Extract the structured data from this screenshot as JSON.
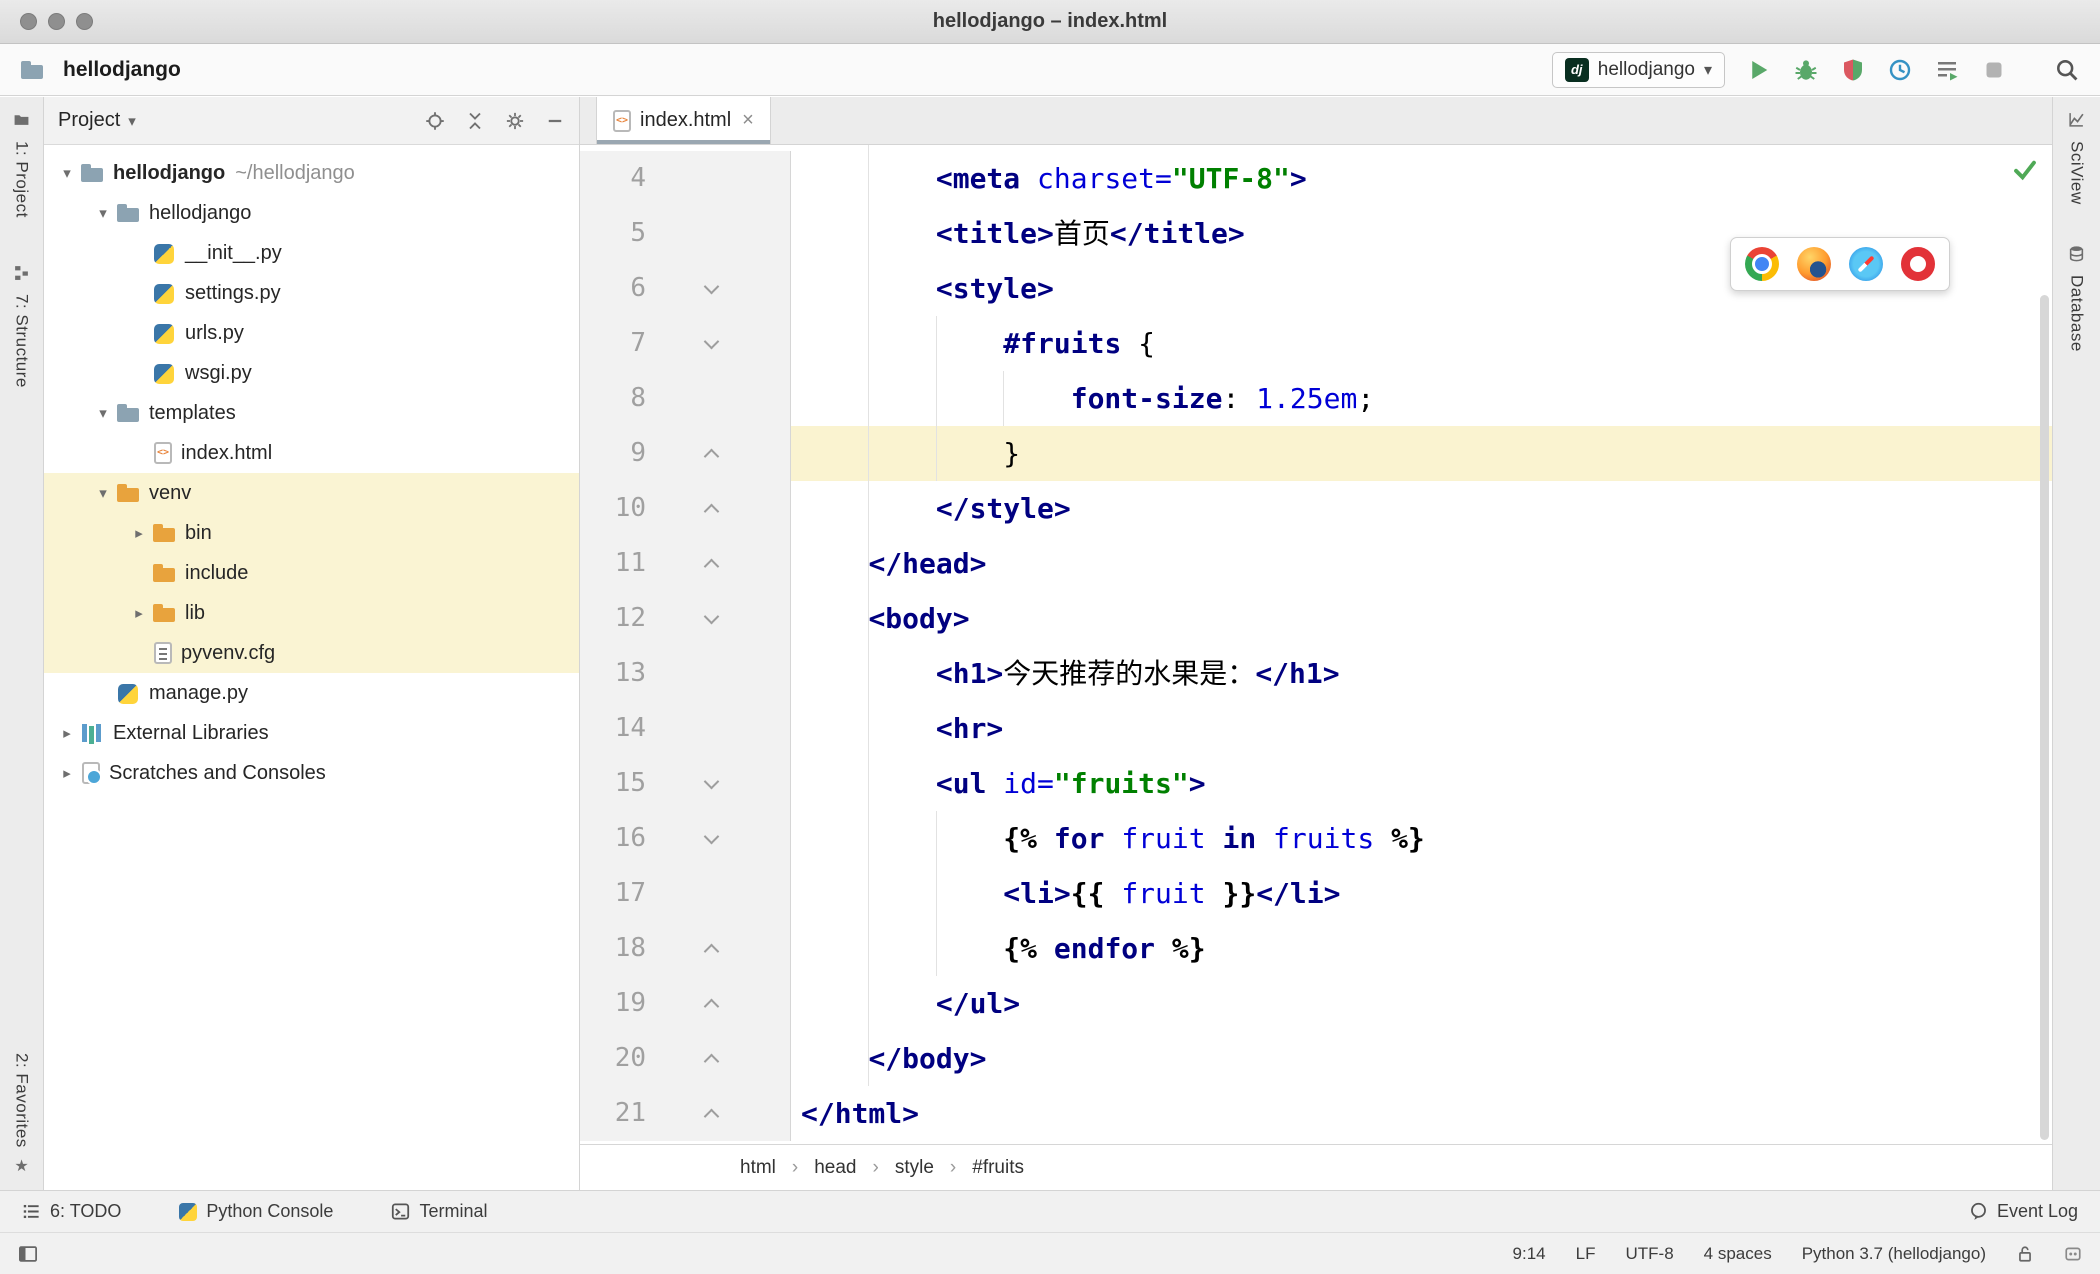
{
  "window": {
    "title": "hellodjango – index.html"
  },
  "toolbar": {
    "project_name": "hellodjango",
    "run_config": {
      "badge": "dj",
      "name": "hellodjango"
    }
  },
  "left_stripe": {
    "project": "1: Project",
    "structure": "7: Structure",
    "favorites": "2: Favorites"
  },
  "right_stripe": {
    "sciview": "SciView",
    "database": "Database"
  },
  "project_panel": {
    "title": "Project",
    "tree": [
      {
        "indent": 0,
        "chevron": "down",
        "icon": "folder-blue",
        "label": "hellodjango",
        "suffix": "~/hellodjango",
        "bold": true
      },
      {
        "indent": 1,
        "chevron": "down",
        "icon": "folder-blue",
        "label": "hellodjango"
      },
      {
        "indent": 2,
        "chevron": null,
        "icon": "python",
        "label": "__init__.py"
      },
      {
        "indent": 2,
        "chevron": null,
        "icon": "python",
        "label": "settings.py"
      },
      {
        "indent": 2,
        "chevron": null,
        "icon": "python",
        "label": "urls.py"
      },
      {
        "indent": 2,
        "chevron": null,
        "icon": "python",
        "label": "wsgi.py"
      },
      {
        "indent": 1,
        "chevron": "down",
        "icon": "folder-blue",
        "label": "templates"
      },
      {
        "indent": 2,
        "chevron": null,
        "icon": "html-file",
        "label": "index.html"
      },
      {
        "indent": 1,
        "chevron": "down",
        "icon": "folder-orange",
        "label": "venv",
        "hl": true
      },
      {
        "indent": 2,
        "chevron": "right",
        "icon": "folder-orange",
        "label": "bin",
        "hl": true
      },
      {
        "indent": 2,
        "chevron": null,
        "icon": "folder-orange",
        "label": "include",
        "hl": true
      },
      {
        "indent": 2,
        "chevron": "right",
        "icon": "folder-orange",
        "label": "lib",
        "hl": true
      },
      {
        "indent": 2,
        "chevron": null,
        "icon": "cfg-file",
        "label": "pyvenv.cfg",
        "hl": true
      },
      {
        "indent": 1,
        "chevron": null,
        "icon": "python",
        "label": "manage.py"
      },
      {
        "indent": 0,
        "chevron": "right",
        "icon": "libs",
        "label": "External Libraries"
      },
      {
        "indent": 0,
        "chevron": "right",
        "icon": "scratches",
        "label": "Scratches and Consoles"
      }
    ]
  },
  "editor": {
    "tab": {
      "name": "index.html"
    },
    "breadcrumbs": [
      "html",
      "head",
      "style",
      "#fruits"
    ],
    "lines": [
      {
        "n": 4,
        "ind": 8,
        "fold": null,
        "t": [
          {
            "c": "tag",
            "s": "<meta "
          },
          {
            "c": "attr",
            "s": "charset="
          },
          {
            "c": "str",
            "s": "\"UTF-8\""
          },
          {
            "c": "tag",
            "s": ">"
          }
        ]
      },
      {
        "n": 5,
        "ind": 8,
        "fold": null,
        "t": [
          {
            "c": "tag",
            "s": "<title>"
          },
          {
            "c": "txt",
            "s": "首页"
          },
          {
            "c": "tag",
            "s": "</title>"
          }
        ]
      },
      {
        "n": 6,
        "ind": 8,
        "fold": "down",
        "t": [
          {
            "c": "tag",
            "s": "<style>"
          }
        ]
      },
      {
        "n": 7,
        "ind": 12,
        "fold": "down",
        "t": [
          {
            "c": "kw",
            "s": "#fruits"
          },
          {
            "c": "pun",
            "s": " {"
          }
        ]
      },
      {
        "n": 8,
        "ind": 16,
        "fold": null,
        "t": [
          {
            "c": "prop",
            "s": "font-size"
          },
          {
            "c": "pun",
            "s": ": "
          },
          {
            "c": "num",
            "s": "1.25em"
          },
          {
            "c": "pun",
            "s": ";"
          }
        ]
      },
      {
        "n": 9,
        "ind": 12,
        "fold": "up",
        "active": true,
        "t": [
          {
            "c": "pun",
            "s": "}"
          }
        ]
      },
      {
        "n": 10,
        "ind": 8,
        "fold": "up",
        "t": [
          {
            "c": "tag",
            "s": "</style>"
          }
        ]
      },
      {
        "n": 11,
        "ind": 4,
        "fold": "up",
        "t": [
          {
            "c": "tag",
            "s": "</head>"
          }
        ]
      },
      {
        "n": 12,
        "ind": 4,
        "fold": "down",
        "t": [
          {
            "c": "tag",
            "s": "<body>"
          }
        ]
      },
      {
        "n": 13,
        "ind": 8,
        "fold": null,
        "t": [
          {
            "c": "tag",
            "s": "<h1>"
          },
          {
            "c": "txt",
            "s": "今天推荐的水果是："
          },
          {
            "c": "tag",
            "s": "</h1>"
          }
        ]
      },
      {
        "n": 14,
        "ind": 8,
        "fold": null,
        "t": [
          {
            "c": "tag",
            "s": "<hr>"
          }
        ]
      },
      {
        "n": 15,
        "ind": 8,
        "fold": "down",
        "t": [
          {
            "c": "tag",
            "s": "<ul "
          },
          {
            "c": "attr",
            "s": "id="
          },
          {
            "c": "str",
            "s": "\"fruits\""
          },
          {
            "c": "tag",
            "s": ">"
          }
        ]
      },
      {
        "n": 16,
        "ind": 12,
        "fold": "down",
        "t": [
          {
            "c": "brc",
            "s": "{% "
          },
          {
            "c": "kw",
            "s": "for"
          },
          {
            "c": "pun",
            "s": " "
          },
          {
            "c": "var",
            "s": "fruit"
          },
          {
            "c": "pun",
            "s": " "
          },
          {
            "c": "kw",
            "s": "in"
          },
          {
            "c": "pun",
            "s": " "
          },
          {
            "c": "var",
            "s": "fruits"
          },
          {
            "c": "pun",
            "s": " "
          },
          {
            "c": "brc",
            "s": "%}"
          }
        ]
      },
      {
        "n": 17,
        "ind": 12,
        "fold": null,
        "t": [
          {
            "c": "tag",
            "s": "<li>"
          },
          {
            "c": "brc",
            "s": "{{ "
          },
          {
            "c": "var",
            "s": "fruit"
          },
          {
            "c": "brc",
            "s": " }}"
          },
          {
            "c": "tag",
            "s": "</li>"
          }
        ]
      },
      {
        "n": 18,
        "ind": 12,
        "fold": "up",
        "t": [
          {
            "c": "brc",
            "s": "{% "
          },
          {
            "c": "kw",
            "s": "endfor"
          },
          {
            "c": "pun",
            "s": " "
          },
          {
            "c": "brc",
            "s": "%}"
          }
        ]
      },
      {
        "n": 19,
        "ind": 8,
        "fold": "up",
        "t": [
          {
            "c": "tag",
            "s": "</ul>"
          }
        ]
      },
      {
        "n": 20,
        "ind": 4,
        "fold": "up",
        "t": [
          {
            "c": "tag",
            "s": "</body>"
          }
        ]
      },
      {
        "n": 21,
        "ind": 0,
        "fold": "up",
        "t": [
          {
            "c": "tag",
            "s": "</html>"
          }
        ]
      }
    ]
  },
  "bottom_bar": {
    "todo": "6: TODO",
    "python_console": "Python Console",
    "terminal": "Terminal",
    "event_log": "Event Log"
  },
  "status_bar": {
    "items": [
      "9:14",
      "LF",
      "UTF-8",
      "4 spaces",
      "Python 3.7 (hellodjango)"
    ]
  },
  "colors": {
    "accent_green": "#59A869",
    "folder_blue": "#8CA3B2",
    "folder_orange": "#E8A33D",
    "caret_line": "#FAF3D0",
    "tree_highlight": "#FAF4D3",
    "tag_navy": "#000080",
    "attr_blue": "#0000D6",
    "string_green": "#008000",
    "django_badge": "#092E20"
  }
}
